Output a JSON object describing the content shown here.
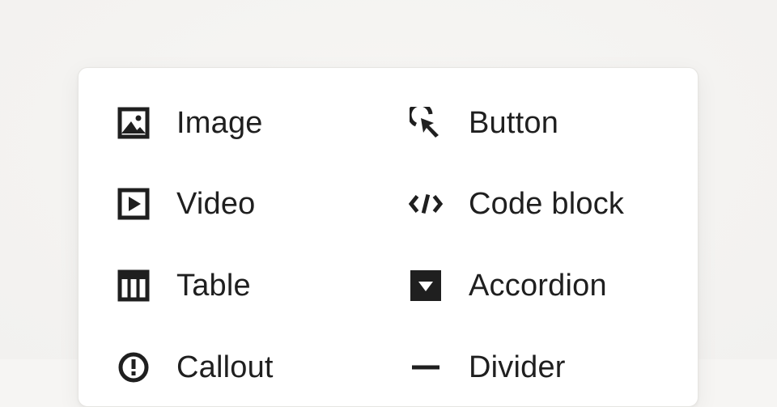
{
  "menu": {
    "items": [
      {
        "label": "Image",
        "icon": "image-icon"
      },
      {
        "label": "Button",
        "icon": "cursor-click-icon"
      },
      {
        "label": "Video",
        "icon": "video-play-icon"
      },
      {
        "label": "Code block",
        "icon": "code-icon"
      },
      {
        "label": "Table",
        "icon": "table-icon"
      },
      {
        "label": "Accordion",
        "icon": "accordion-icon"
      },
      {
        "label": "Callout",
        "icon": "callout-icon"
      },
      {
        "label": "Divider",
        "icon": "divider-icon"
      }
    ]
  },
  "colors": {
    "background": "#f6f5f3",
    "panel": "#ffffff",
    "text": "#1f1f1f",
    "icon": "#1f1f1f"
  }
}
